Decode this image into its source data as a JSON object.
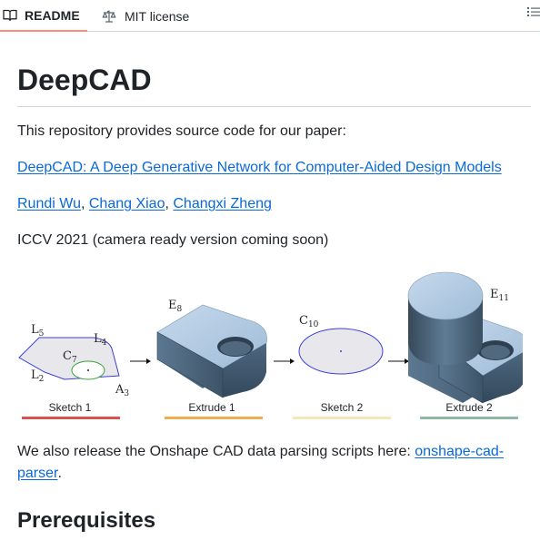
{
  "tabs": {
    "readme_label": "README",
    "license_label": "MIT license"
  },
  "readme": {
    "title": "DeepCAD",
    "intro": "This repository provides source code for our paper:",
    "paper_link": "DeepCAD: A Deep Generative Network for Computer-Aided Design Models",
    "authors": [
      {
        "name": "Rundi Wu",
        "sep": ", "
      },
      {
        "name": "Chang Xiao",
        "sep": ", "
      },
      {
        "name": "Changxi Zheng",
        "sep": ""
      }
    ],
    "venue": "ICCV 2021 (camera ready version coming soon)",
    "parser_text": "We also release the Onshape CAD data parsing scripts here:",
    "parser_link_line1": "onshape-cad-",
    "parser_link_line2": "parser",
    "parser_end": ".",
    "section_heading": "Prerequisites"
  },
  "figure": {
    "steps": [
      {
        "caption": "Sketch 1",
        "color": "#d9534f"
      },
      {
        "caption": "Extrude 1",
        "color": "#f0ad4e"
      },
      {
        "caption": "Sketch 2",
        "color": "#f5e6b8"
      },
      {
        "caption": "Extrude 2",
        "color": "#8fb7a3"
      }
    ],
    "labels": {
      "L5": {
        "main": "L",
        "sub": "5"
      },
      "L4": {
        "main": "L",
        "sub": "4"
      },
      "C7": {
        "main": "C",
        "sub": "7"
      },
      "L2": {
        "main": "L",
        "sub": "2"
      },
      "A3": {
        "main": "A",
        "sub": "3"
      },
      "E8": {
        "main": "E",
        "sub": "8"
      },
      "C10": {
        "main": "C",
        "sub": "10"
      },
      "E11": {
        "main": "E",
        "sub": "11"
      }
    }
  }
}
